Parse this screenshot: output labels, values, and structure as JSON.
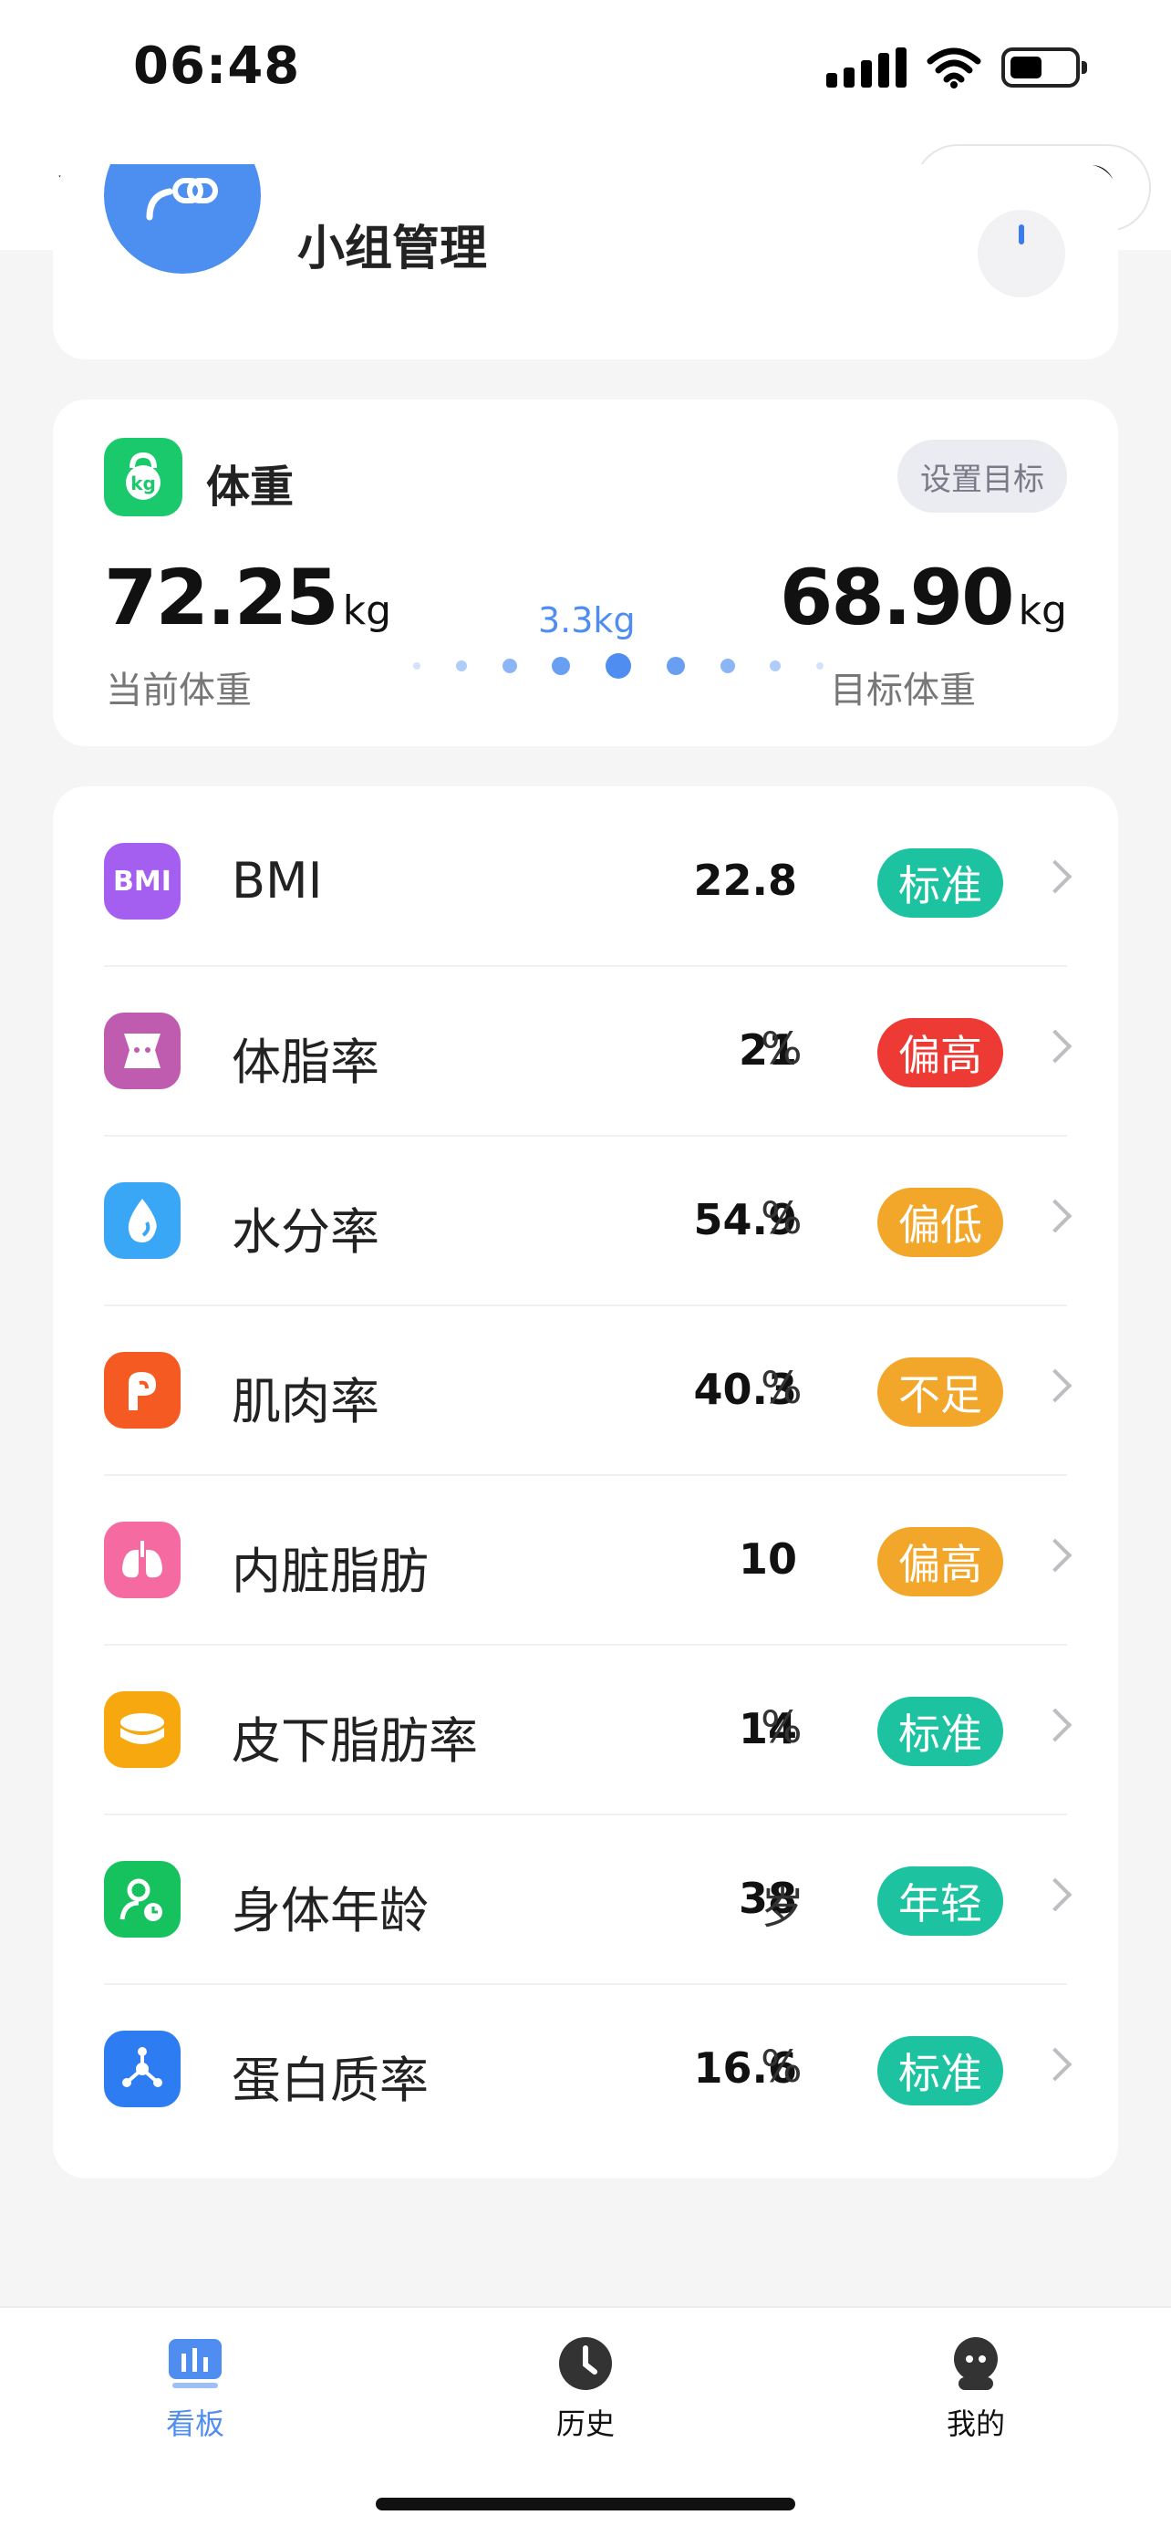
{
  "status_bar": {
    "time": "06:48"
  },
  "nav": {
    "title": "看板"
  },
  "group": {
    "name": "小组管理"
  },
  "weight": {
    "title": "体重",
    "set_goal": "设置目标",
    "current_value": "72.25",
    "current_unit": "kg",
    "current_label": "当前体重",
    "diff": "3.3kg",
    "target_value": "68.90",
    "target_unit": "kg",
    "target_label": "目标体重"
  },
  "metrics": [
    {
      "name": "BMI",
      "value": "22.8",
      "unit": "",
      "status": "标准",
      "status_color": "#1dc3a0",
      "icon": "bmi-icon",
      "icon_color": "#a45ff0"
    },
    {
      "name": "体脂率",
      "value": "21",
      "unit": "%",
      "status": "偏高",
      "status_color": "#ee3a34",
      "icon": "body-fat-icon",
      "icon_color": "#c05cb0"
    },
    {
      "name": "水分率",
      "value": "54.9",
      "unit": "%",
      "status": "偏低",
      "status_color": "#f3a72a",
      "icon": "water-drop-icon",
      "icon_color": "#3aa6f6"
    },
    {
      "name": "肌肉率",
      "value": "40.3",
      "unit": "%",
      "status": "不足",
      "status_color": "#f3a72a",
      "icon": "muscle-icon",
      "icon_color": "#f55a22"
    },
    {
      "name": "内脏脂肪",
      "value": "10",
      "unit": "",
      "status": "偏高",
      "status_color": "#f3a72a",
      "icon": "lungs-icon",
      "icon_color": "#f56aa0"
    },
    {
      "name": "皮下脂肪率",
      "value": "14",
      "unit": "%",
      "status": "标准",
      "status_color": "#1dc3a0",
      "icon": "fat-layer-icon",
      "icon_color": "#f6a80e"
    },
    {
      "name": "身体年龄",
      "value": "38",
      "unit": "岁",
      "status": "年轻",
      "status_color": "#1dc3a0",
      "icon": "body-age-icon",
      "icon_color": "#15c25e"
    },
    {
      "name": "蛋白质率",
      "value": "16.6",
      "unit": "%",
      "status": "标准",
      "status_color": "#1dc3a0",
      "icon": "protein-molecule-icon",
      "icon_color": "#2d7cf2"
    }
  ],
  "tabs": [
    {
      "label": "看板",
      "icon": "dashboard-icon",
      "active": true
    },
    {
      "label": "历史",
      "icon": "clock-icon",
      "active": false
    },
    {
      "label": "我的",
      "icon": "profile-icon",
      "active": false
    }
  ]
}
